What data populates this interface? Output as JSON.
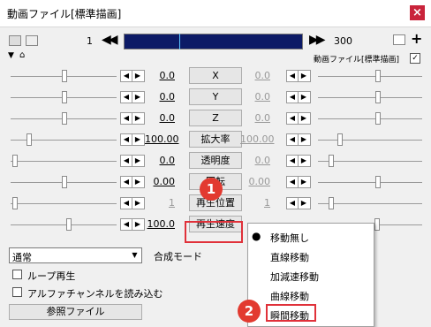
{
  "window": {
    "title": "動画ファイル[標準描画]",
    "close_glyph": "×"
  },
  "toolbar": {
    "start_frame": "1",
    "end_frame": "300",
    "object_label": "動画ファイル[標準描画]",
    "progress_fraction": 0.31
  },
  "params": [
    {
      "label": "X",
      "left": "0.0",
      "right": "0.0"
    },
    {
      "label": "Y",
      "left": "0.0",
      "right": "0.0"
    },
    {
      "label": "Z",
      "left": "0.0",
      "right": "0.0"
    },
    {
      "label": "拡大率",
      "left": "100.00",
      "right": "100.00"
    },
    {
      "label": "透明度",
      "left": "0.0",
      "right": "0.0"
    },
    {
      "label": "回転",
      "left": "0.00",
      "right": "0.00"
    },
    {
      "label": "再生位置",
      "left": "1",
      "right": "1"
    },
    {
      "label": "再生速度",
      "left": "100.0",
      "right": ""
    }
  ],
  "arrows": {
    "left": "◀",
    "right": "▶"
  },
  "blend": {
    "value": "通常",
    "label": "合成モード",
    "arrow": "▼"
  },
  "checkbox_loop": "ループ再生",
  "checkbox_alpha": "アルファチャンネルを読み込む",
  "reference_button": "参照ファイル",
  "move_menu": {
    "bullet": "●",
    "items": [
      "移動無し",
      "直線移動",
      "加減速移動",
      "曲線移動",
      "瞬間移動"
    ],
    "selected": "瞬間移動"
  },
  "callouts": [
    "1",
    "2"
  ],
  "colors": {
    "highlight": "#e0313a",
    "seek": "#0c1a66",
    "badge": "#e23a30"
  }
}
